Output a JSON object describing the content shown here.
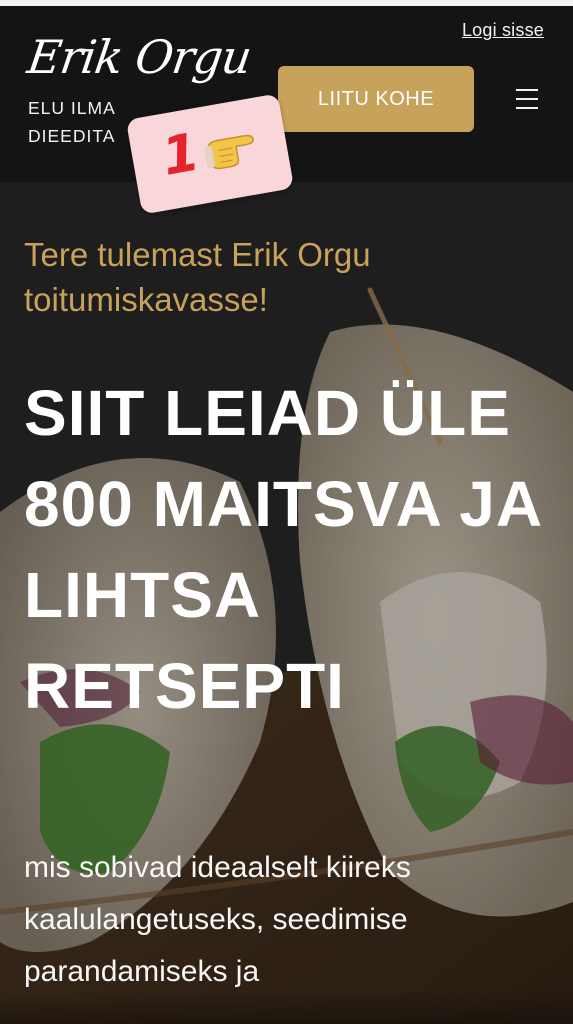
{
  "header": {
    "login_label": "Logi sisse",
    "logo_name": "Erik Orgu",
    "logo_tagline": "ELU ILMA DIEEDITA",
    "cta_label": "LIITU KOHE",
    "menu_icon": "hamburger-menu-icon"
  },
  "badge": {
    "number": "1",
    "icon": "pointing-hand-icon"
  },
  "hero": {
    "welcome": "Tere tulemast Erik Orgu toitumiskavasse!",
    "headline": "SIIT LEIAD ÜLE 800 MAITSVA JA LIHTSA RETSEPTI",
    "subtext": "mis sobivad ideaalselt kiireks kaalulangetuseks, seedimise parandamiseks ja"
  },
  "colors": {
    "header_bg": "#141414",
    "accent_gold": "#c7a25b",
    "badge_bg": "#f9d6d9",
    "badge_number": "#e5242a",
    "text_white": "#ffffff"
  }
}
